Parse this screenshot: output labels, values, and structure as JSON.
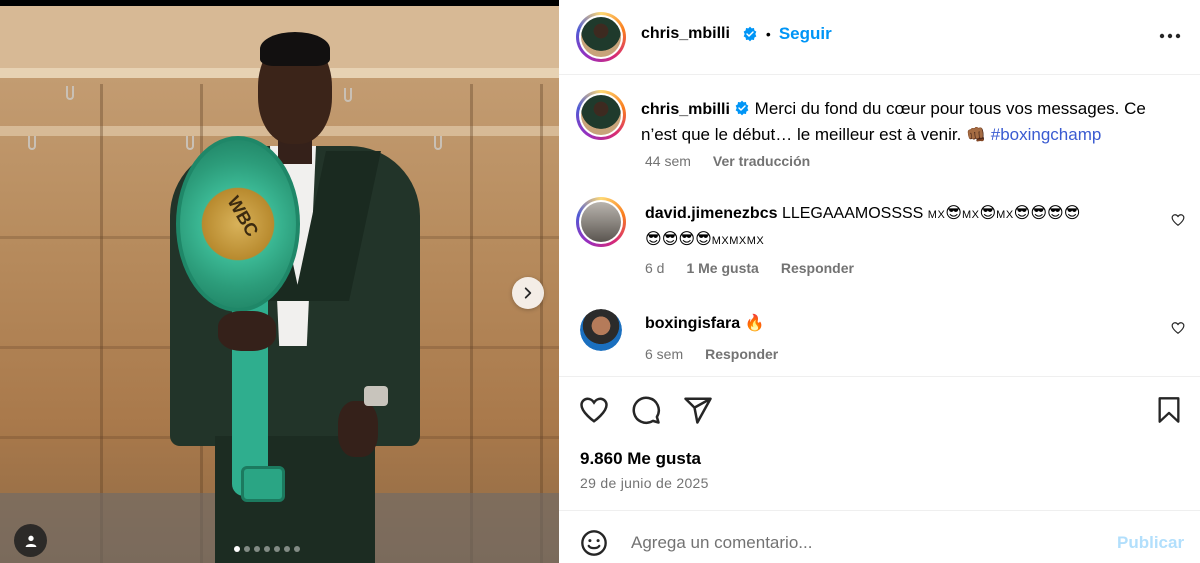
{
  "post": {
    "author": "chris_mbilli",
    "follow_label": "Seguir",
    "bullet": "•",
    "more_label": "•••",
    "caption_text": "Merci du fond du cœur pour tous vos messages. Ce n’est que le début… le meilleur est à venir. ",
    "caption_emoji": "👊🏾",
    "caption_hashtag": "#boxingchamp",
    "caption_age": "44 sem",
    "translate_label": "Ver traducción",
    "likes": "9.860 Me gusta",
    "date": "29 de junio de 2025",
    "belt_text": "WBC"
  },
  "comments": [
    {
      "username": "david.jimenezbcs",
      "text_line1": "LLEGAAAMOSSSS ",
      "emoji_line1": [
        "MX",
        "😎",
        "MX",
        "😎",
        "MX",
        "😎",
        "😎",
        "😎",
        "😎"
      ],
      "emoji_line2": [
        "😎",
        "😎",
        "😎",
        "😎",
        "MXMXMX"
      ],
      "age": "6 d",
      "likes": "1 Me gusta",
      "reply_label": "Responder"
    },
    {
      "username": "boxingisfara",
      "emoji": "🔥",
      "age": "6 sem",
      "reply_label": "Responder"
    }
  ],
  "comment_box": {
    "placeholder": "Agrega un comentario...",
    "publish_label": "Publicar"
  },
  "carousel": {
    "total": 7,
    "active_index": 0
  },
  "colors": {
    "accent": "#0095f6",
    "hashtag": "#3a5bd1",
    "muted": "#737373",
    "publish_disabled": "#b2dffc"
  },
  "icons": [
    "chevron-right-icon",
    "person-tag-icon",
    "verified-icon",
    "more-icon",
    "heart-icon",
    "comment-icon",
    "share-icon",
    "bookmark-icon",
    "emoji-icon"
  ]
}
